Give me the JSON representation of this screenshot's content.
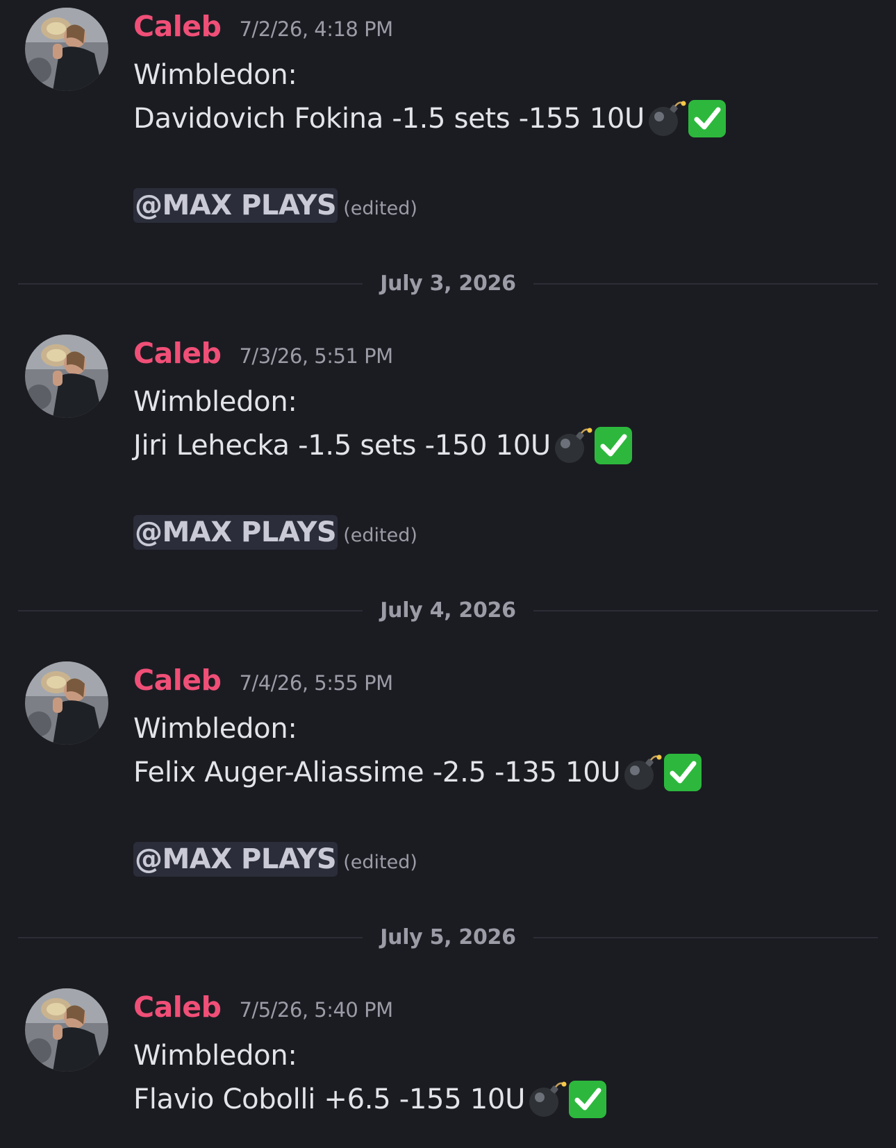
{
  "messages": [
    {
      "author": "Caleb",
      "timestamp": "7/2/26, 4:18 PM",
      "line1": "Wimbledon:",
      "line2": "Davidovich Fokina -1.5 sets -155 10U",
      "emojis": [
        "bomb-emoji",
        "check-mark-emoji"
      ],
      "mention": "@MAX PLAYS",
      "edited": "(edited)"
    },
    {
      "author": "Caleb",
      "timestamp": "7/3/26, 5:51 PM",
      "line1": "Wimbledon:",
      "line2": "Jiri Lehecka -1.5 sets -150 10U",
      "emojis": [
        "bomb-emoji",
        "check-mark-emoji"
      ],
      "mention": "@MAX PLAYS",
      "edited": "(edited)"
    },
    {
      "author": "Caleb",
      "timestamp": "7/4/26, 5:55 PM",
      "line1": "Wimbledon:",
      "line2": "Felix Auger-Aliassime -2.5 -135 10U",
      "emojis": [
        "bomb-emoji",
        "check-mark-emoji"
      ],
      "mention": "@MAX PLAYS",
      "edited": "(edited)"
    },
    {
      "author": "Caleb",
      "timestamp": "7/5/26, 5:40 PM",
      "line1": "Wimbledon:",
      "line2": "Flavio Cobolli +6.5 -155 10U",
      "emojis": [
        "bomb-emoji",
        "check-mark-emoji"
      ]
    }
  ],
  "dividers": [
    {
      "date": "July 3, 2026"
    },
    {
      "date": "July 4, 2026"
    },
    {
      "date": "July 5, 2026"
    }
  ],
  "colors": {
    "background": "#1b1c22",
    "author": "#f04f77",
    "text": "#e3e4ea",
    "muted": "#9b9ca6",
    "mention_bg": "#2b2e3a",
    "check_green": "#2db83d"
  },
  "icons": {
    "avatar": "avatar",
    "bomb": "bomb-emoji",
    "check": "check-mark-emoji"
  }
}
